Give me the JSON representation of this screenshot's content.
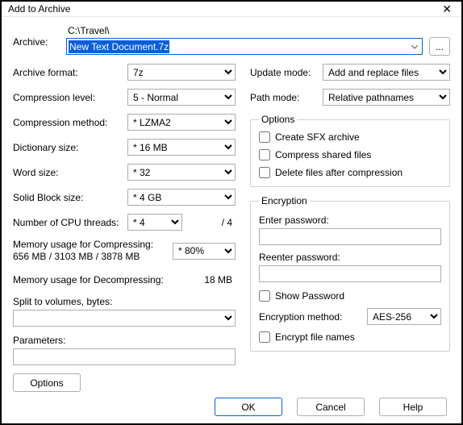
{
  "window": {
    "title": "Add to Archive"
  },
  "archive": {
    "label": "Archive:",
    "path": "C:\\Travel\\",
    "file": "New Text Document.7z",
    "browse": "..."
  },
  "left": {
    "format": {
      "label": "Archive format:",
      "value": "7z"
    },
    "level": {
      "label": "Compression level:",
      "value": "5 - Normal"
    },
    "method": {
      "label": "Compression method:",
      "value": "* LZMA2"
    },
    "dict": {
      "label": "Dictionary size:",
      "value": "* 16 MB"
    },
    "word": {
      "label": "Word size:",
      "value": "* 32"
    },
    "block": {
      "label": "Solid Block size:",
      "value": "* 4 GB"
    },
    "threads": {
      "label": "Number of CPU threads:",
      "value": "* 4",
      "info": "/ 4"
    },
    "mem_comp": {
      "label1": "Memory usage for Compressing:",
      "label2": "656 MB / 3103 MB / 3878 MB",
      "value": "* 80%"
    },
    "mem_decomp": {
      "label": "Memory usage for Decompressing:",
      "value": "18 MB"
    },
    "split": {
      "label": "Split to volumes, bytes:",
      "value": ""
    },
    "params": {
      "label": "Parameters:",
      "value": ""
    },
    "options_btn": "Options"
  },
  "right": {
    "update": {
      "label": "Update mode:",
      "value": "Add and replace files"
    },
    "pathmode": {
      "label": "Path mode:",
      "value": "Relative pathnames"
    },
    "options": {
      "legend": "Options",
      "sfx": "Create SFX archive",
      "shared": "Compress shared files",
      "delete": "Delete files after compression"
    },
    "encryption": {
      "legend": "Encryption",
      "enter": "Enter password:",
      "reenter": "Reenter password:",
      "show": "Show Password",
      "method_label": "Encryption method:",
      "method_value": "AES-256",
      "names": "Encrypt file names"
    }
  },
  "buttons": {
    "ok": "OK",
    "cancel": "Cancel",
    "help": "Help"
  }
}
